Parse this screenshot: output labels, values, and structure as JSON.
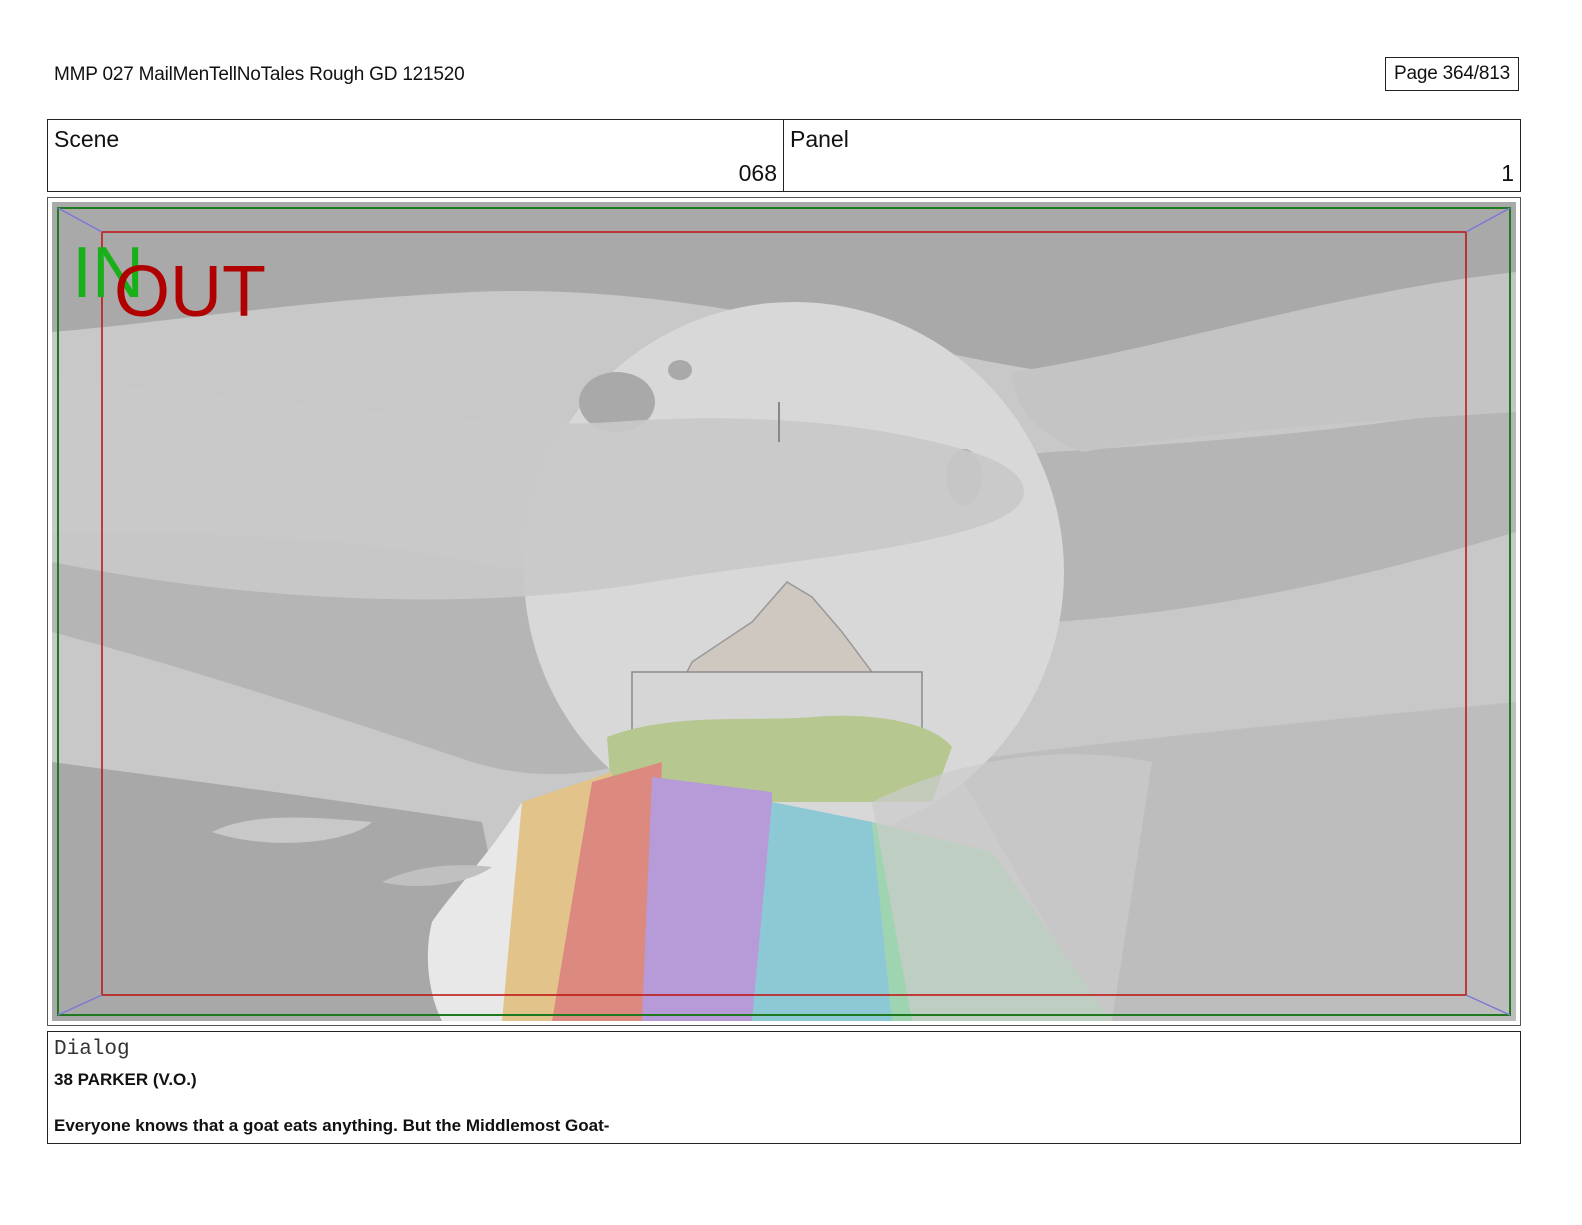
{
  "header": {
    "doc_title": "MMP 027 MailMenTellNoTales Rough GD 121520",
    "page_label": "Page 364/813"
  },
  "scene": {
    "label": "Scene",
    "value": "068"
  },
  "panel": {
    "label": "Panel",
    "value": "1"
  },
  "frame": {
    "in_marker": "IN",
    "out_marker": "OUT",
    "colors": {
      "in": "#18b018",
      "out": "#b00000",
      "safe_frame_green": "#1f7a1f",
      "safe_frame_red": "#c01818",
      "corner_arrows": "#7a78d8"
    }
  },
  "dialog": {
    "label": "Dialog",
    "speaker": "38 PARKER (V.O.)",
    "line": "Everyone knows that a goat eats anything. But the Middlemost Goat-"
  }
}
